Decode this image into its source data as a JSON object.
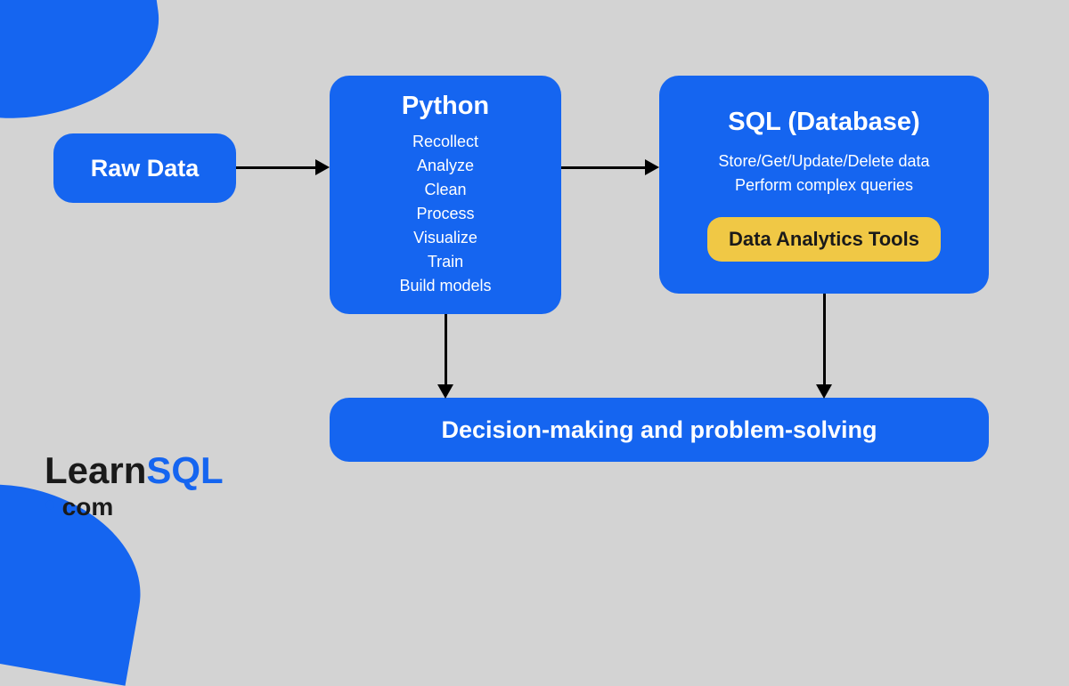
{
  "nodes": {
    "rawData": {
      "title": "Raw Data"
    },
    "python": {
      "title": "Python",
      "items": [
        "Recollect",
        "Analyze",
        "Clean",
        "Process",
        "Visualize",
        "Train",
        "Build models"
      ]
    },
    "sql": {
      "title": "SQL (Database)",
      "items": [
        "Store/Get/Update/Delete data",
        "Perform complex queries"
      ],
      "badge": "Data Analytics Tools"
    },
    "decision": {
      "title": "Decision-making and problem-solving"
    }
  },
  "logo": {
    "learn": "Learn",
    "sql": "SQL",
    "dot": "•",
    "com": " com"
  }
}
